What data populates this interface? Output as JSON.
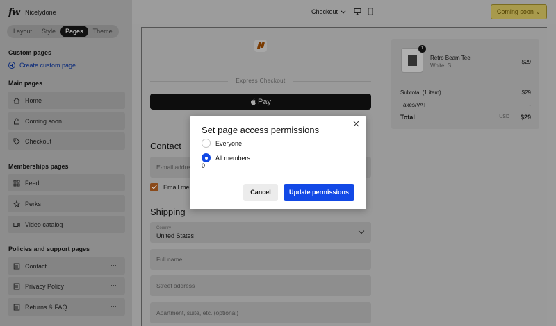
{
  "app": {
    "logo": "fw",
    "site_name": "Nicelydone"
  },
  "sidebar": {
    "tabs": [
      {
        "label": "Layout",
        "active": false
      },
      {
        "label": "Style",
        "active": false
      },
      {
        "label": "Pages",
        "active": true
      },
      {
        "label": "Theme",
        "active": false
      }
    ],
    "custom_pages": {
      "title": "Custom pages",
      "create_label": "Create custom page"
    },
    "main_pages": {
      "title": "Main pages",
      "items": [
        {
          "label": "Home",
          "icon": "home-icon"
        },
        {
          "label": "Coming soon",
          "icon": "lock-icon"
        },
        {
          "label": "Checkout",
          "icon": "tag-icon"
        }
      ]
    },
    "memberships_pages": {
      "title": "Memberships pages",
      "items": [
        {
          "label": "Feed",
          "icon": "grid-icon"
        },
        {
          "label": "Perks",
          "icon": "star-icon"
        },
        {
          "label": "Video catalog",
          "icon": "video-icon"
        }
      ]
    },
    "policies_pages": {
      "title": "Policies and support pages",
      "items": [
        {
          "label": "Contact",
          "icon": "document-icon",
          "more": "···"
        },
        {
          "label": "Privacy Policy",
          "icon": "document-icon",
          "more": "···"
        },
        {
          "label": "Returns & FAQ",
          "icon": "document-icon",
          "more": "···"
        }
      ]
    }
  },
  "topbar": {
    "page_select": "Checkout",
    "devices": [
      "desktop-icon",
      "mobile-icon"
    ],
    "status_button": "Coming soon"
  },
  "preview": {
    "express_label": "Express Checkout",
    "apple_pay": "Pay",
    "contact_heading": "Contact",
    "email_placeholder": "E-mail address",
    "email_me_label": "Email me",
    "shipping_heading": "Shipping",
    "country_label": "Country",
    "country_value": "United States",
    "full_name_placeholder": "Full name",
    "street_placeholder": "Street address",
    "apartment_placeholder": "Apartment, suite, etc. (optional)",
    "summary": {
      "item_name": "Retro Beam Tee",
      "item_variant": "White, S",
      "item_price": "$29",
      "item_qty": "1",
      "subtotal_label": "Subtotal (1 item)",
      "subtotal_value": "$29",
      "taxes_label": "Taxes/VAT",
      "taxes_value": "-",
      "total_label": "Total",
      "total_currency": "USD",
      "total_value": "$29"
    }
  },
  "modal": {
    "title": "Set page access permissions",
    "options": [
      {
        "label": "Everyone",
        "selected": false
      },
      {
        "label": "All members",
        "selected": true
      }
    ],
    "stray_value": "0",
    "cancel_label": "Cancel",
    "confirm_label": "Update permissions",
    "accent_color": "#1249e6"
  }
}
